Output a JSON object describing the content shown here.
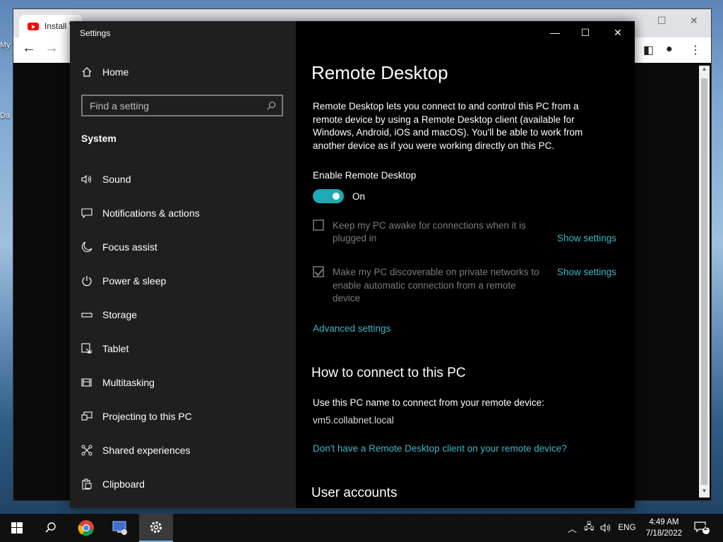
{
  "desktop": {
    "icon1": "My",
    "icon2": "Da"
  },
  "browser": {
    "tab_title": "Install V"
  },
  "settings": {
    "window_title": "Settings",
    "home_label": "Home",
    "search_placeholder": "Find a setting",
    "section": "System",
    "nav": [
      {
        "label": "Sound",
        "icon": "speaker-icon"
      },
      {
        "label": "Notifications & actions",
        "icon": "message-icon"
      },
      {
        "label": "Focus assist",
        "icon": "moon-icon"
      },
      {
        "label": "Power & sleep",
        "icon": "power-icon"
      },
      {
        "label": "Storage",
        "icon": "storage-icon"
      },
      {
        "label": "Tablet",
        "icon": "tablet-icon"
      },
      {
        "label": "Multitasking",
        "icon": "multitasking-icon"
      },
      {
        "label": "Projecting to this PC",
        "icon": "projector-icon"
      },
      {
        "label": "Shared experiences",
        "icon": "share-icon"
      },
      {
        "label": "Clipboard",
        "icon": "clipboard-icon"
      }
    ],
    "page_title": "Remote Desktop",
    "description": "Remote Desktop lets you connect to and control this PC from a remote device by using a Remote Desktop client (available for Windows, Android, iOS and macOS). You'll be able to work from another device as if you were working directly on this PC.",
    "enable_label": "Enable Remote Desktop",
    "toggle_state": "On",
    "option1_line1": "Keep my PC awake for connections when it is",
    "option1_line2": "plugged in",
    "option1_checked": false,
    "option2_line1": "Make my PC discoverable on private networks to",
    "option2_line2": "enable automatic connection from a remote",
    "option2_line3": "device",
    "option2_checked": true,
    "show_settings": "Show settings",
    "advanced": "Advanced settings",
    "connect_heading": "How to connect to this PC",
    "connect_text": "Use this PC name to connect from your remote device:",
    "pc_name": "vm5.collabnet.local",
    "client_link": "Don't have a Remote Desktop client on your remote device?",
    "accounts_heading": "User accounts"
  },
  "taskbar": {
    "lang": "ENG",
    "time": "4:49 AM",
    "date": "7/18/2022",
    "notifications": "2"
  },
  "colors": {
    "accent": "#1ea9b5",
    "link": "#3fb8c4"
  }
}
